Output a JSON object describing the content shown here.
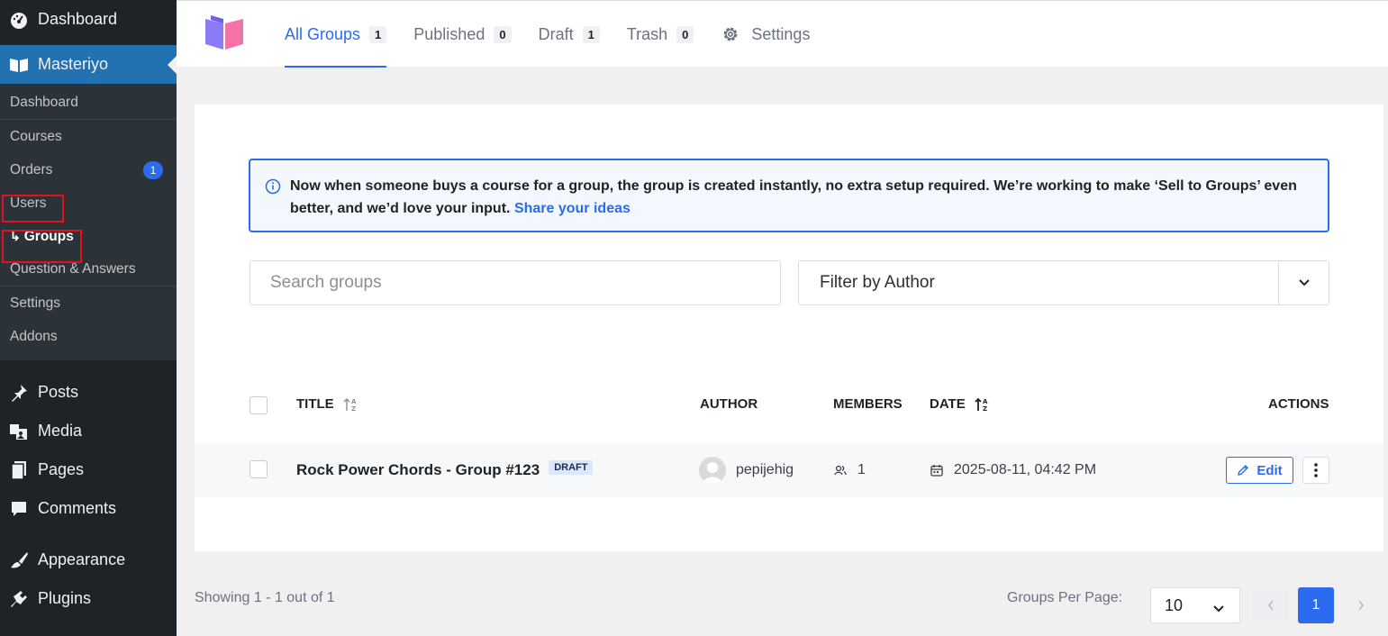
{
  "sidebar": {
    "top_items": [
      {
        "label": "Dashboard",
        "icon": "dashboard-icon"
      },
      {
        "label": "Masteriyo",
        "icon": "masteriyo-icon"
      }
    ],
    "submenu": [
      {
        "label": "Dashboard"
      },
      {
        "label": "Courses"
      },
      {
        "label": "Orders",
        "badge": "1"
      },
      {
        "label": "Users"
      },
      {
        "label": "Groups",
        "prefix": "↳"
      },
      {
        "label": "Question & Answers"
      },
      {
        "label": "Settings"
      },
      {
        "label": "Addons"
      }
    ],
    "bottom_items": [
      {
        "label": "Posts",
        "icon": "pushpin-icon"
      },
      {
        "label": "Media",
        "icon": "media-icon"
      },
      {
        "label": "Pages",
        "icon": "pages-icon"
      },
      {
        "label": "Comments",
        "icon": "comment-icon"
      },
      {
        "label": "Appearance",
        "icon": "paintbrush-icon"
      },
      {
        "label": "Plugins",
        "icon": "plugin-icon"
      }
    ]
  },
  "tabs": [
    {
      "label": "All Groups",
      "count": "1",
      "active": true
    },
    {
      "label": "Published",
      "count": "0"
    },
    {
      "label": "Draft",
      "count": "1"
    },
    {
      "label": "Trash",
      "count": "0"
    },
    {
      "label": "Settings",
      "icon": "gear-icon"
    }
  ],
  "notice": {
    "text": "Now when someone buys a course for a group, the group is created instantly, no extra setup required. We’re working to make ‘Sell to Groups’ even better, and we’d love your input.",
    "link": "Share your ideas"
  },
  "search": {
    "placeholder": "Search groups"
  },
  "filter": {
    "label": "Filter by Author"
  },
  "table": {
    "headers": {
      "title": "TITLE",
      "author": "AUTHOR",
      "members": "MEMBERS",
      "date": "DATE",
      "actions": "ACTIONS"
    },
    "rows": [
      {
        "title": "Rock Power Chords - Group #123",
        "status": "DRAFT",
        "author": "pepijehig",
        "members": "1",
        "date": "2025-08-11, 04:42 PM",
        "edit": "Edit"
      }
    ]
  },
  "footer": {
    "showing": "Showing 1 - 1 out of 1",
    "per_page_label": "Groups Per Page:",
    "per_page_value": "10",
    "current_page": "1"
  },
  "colors": {
    "accent": "#2c6bed",
    "sidebar": "#1d2327",
    "highlight": "#e2121e"
  }
}
